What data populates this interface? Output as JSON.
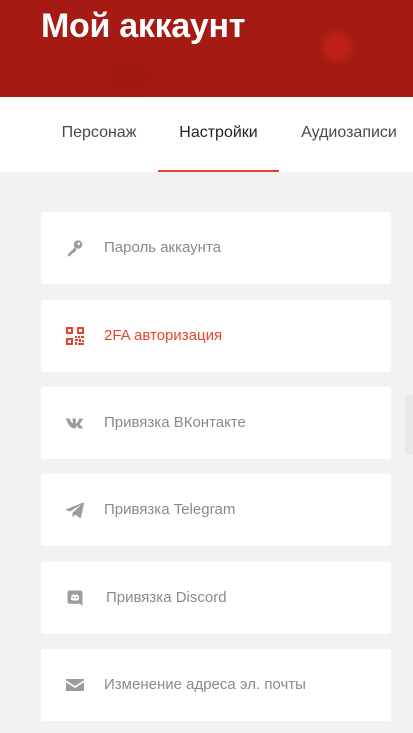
{
  "header": {
    "title": "Мой аккаунт",
    "background_color": "#a51b13"
  },
  "tabs": [
    {
      "label": "Персонаж",
      "active": false
    },
    {
      "label": "Настройки",
      "active": true
    },
    {
      "label": "Аудиозаписи",
      "active": false
    }
  ],
  "accent_color": "#e5432d",
  "settings": [
    {
      "label": "Пароль аккаунта",
      "icon": "key-icon",
      "highlighted": false
    },
    {
      "label": "2FA авторизация",
      "icon": "qr-code-icon",
      "highlighted": true
    },
    {
      "label": "Привязка ВКонтакте",
      "icon": "vk-icon",
      "highlighted": false
    },
    {
      "label": "Привязка Telegram",
      "icon": "telegram-icon",
      "highlighted": false
    },
    {
      "label": "Привязка Discord",
      "icon": "discord-icon",
      "highlighted": false
    },
    {
      "label": "Изменение адреса эл. почты",
      "icon": "envelope-icon",
      "highlighted": false
    }
  ]
}
